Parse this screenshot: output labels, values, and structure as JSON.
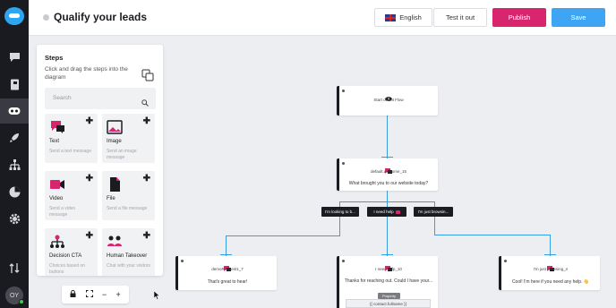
{
  "header": {
    "title": "Qualify your leads",
    "language": "English",
    "test_label": "Test it out",
    "publish_label": "Publish",
    "save_label": "Save"
  },
  "user": {
    "initials": "OY"
  },
  "colors": {
    "accent_blue": "#3ea5f4",
    "publish_pink": "#d9256e",
    "rail_dark": "#1a1b20"
  },
  "steps_panel": {
    "title": "Steps",
    "description": "Click and drag the steps into the diagram",
    "search_placeholder": "Search",
    "cards": [
      {
        "label": "Text",
        "desc": "Send a text message",
        "icon": "chat-icon"
      },
      {
        "label": "Image",
        "desc": "Send an image message",
        "icon": "image-icon"
      },
      {
        "label": "Video",
        "desc": "Send a video message",
        "icon": "video-icon"
      },
      {
        "label": "File",
        "desc": "Send a file message",
        "icon": "file-icon"
      },
      {
        "label": "Decision CTA",
        "desc": "Choices based on buttons",
        "icon": "tree-icon"
      },
      {
        "label": "Human Takeover",
        "desc": "Chat with your visitors",
        "icon": "people-icon"
      }
    ]
  },
  "flow": {
    "start": {
      "name": "Start of Bot Flow"
    },
    "welcome": {
      "name": "default.welcome_15",
      "message": "What brought you to our website today?"
    },
    "choices": [
      "I'm looking to b...",
      "I need help",
      "I'm just browsin..."
    ],
    "nodes": [
      {
        "name": "demoRequest1_7",
        "message": "That's great to hear!"
      },
      {
        "name": "I need help_10",
        "message": "Thanks for reaching out. Could I have your...",
        "property_label": "Property",
        "property_value": "{{ contact.fullname }}"
      },
      {
        "name": "I'm just browsing_n",
        "message": "Cool! I'm here if you need any help. 👋"
      }
    ]
  },
  "zoom_toolbar": {
    "zoom_out": "−",
    "zoom_in": "+"
  }
}
